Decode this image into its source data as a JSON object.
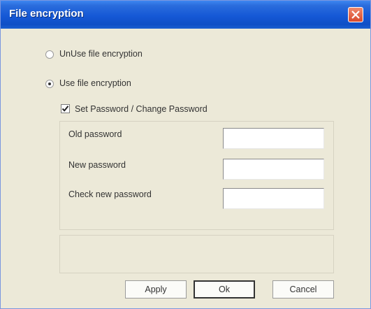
{
  "window": {
    "title": "File encryption"
  },
  "options": {
    "unuse_label": "UnUse file encryption",
    "use_label": "Use file encryption",
    "selected": "use"
  },
  "password": {
    "checkbox_label": "Set Password / Change Password",
    "checked": true,
    "old_label": "Old password",
    "new_label": "New password",
    "check_label": "Check new password",
    "old_value": "",
    "new_value": "",
    "check_value": ""
  },
  "buttons": {
    "apply": "Apply",
    "ok": "Ok",
    "cancel": "Cancel"
  },
  "icons": {
    "close": "close-icon",
    "check": "check-icon"
  },
  "colors": {
    "titlebar": "#1558d6",
    "dialog_bg": "#ece9d8",
    "close": "#d8492b"
  }
}
